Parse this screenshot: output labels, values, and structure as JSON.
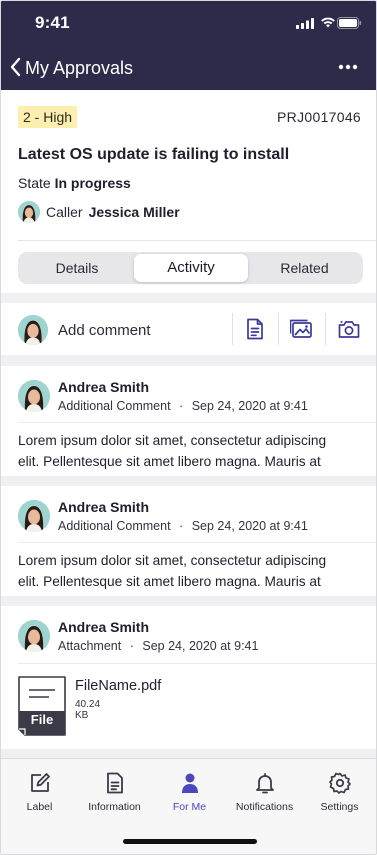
{
  "status_bar": {
    "time": "9:41"
  },
  "nav": {
    "back_label": "My Approvals",
    "more_icon": "ellipsis-icon"
  },
  "record": {
    "priority": "2 - High",
    "number": "PRJ0017046",
    "title": "Latest OS update is failing to install",
    "state_label": "State",
    "state_value": "In progress",
    "caller_label": "Caller",
    "caller_name": "Jessica Miller"
  },
  "tabs": [
    {
      "label": "Details",
      "active": false
    },
    {
      "label": "Activity",
      "active": true
    },
    {
      "label": "Related",
      "active": false
    }
  ],
  "composer": {
    "placeholder": "Add comment",
    "actions": [
      "document-icon",
      "image-icon",
      "camera-icon"
    ]
  },
  "feed": [
    {
      "author": "Andrea Smith",
      "type": "Additional Comment",
      "separator": "·",
      "date": "Sep 24, 2020 at 9:41",
      "body_line1": "Lorem ipsum dolor sit amet, consectetur adipiscing",
      "body_line2": "elit. Pellentesque sit amet libero magna. Mauris at"
    },
    {
      "author": "Andrea Smith",
      "type": "Additional Comment",
      "separator": "·",
      "date": "Sep 24, 2020 at 9:41",
      "body_line1": "Lorem ipsum dolor sit amet, consectetur adipiscing",
      "body_line2": "elit. Pellentesque sit amet libero magna. Mauris at"
    },
    {
      "author": "Andrea Smith",
      "type": "Attachment",
      "separator": "·",
      "date": "Sep 24, 2020 at 9:41",
      "file": {
        "badge": "File",
        "name": "FileName.pdf",
        "size": "40.24 KB"
      }
    }
  ],
  "tabbar": [
    {
      "label": "Label",
      "icon": "pencil-icon",
      "active": false
    },
    {
      "label": "Information",
      "icon": "document-icon",
      "active": false
    },
    {
      "label": "For Me",
      "icon": "person-icon",
      "active": true
    },
    {
      "label": "Notifications",
      "icon": "bell-icon",
      "active": false
    },
    {
      "label": "Settings",
      "icon": "gear-icon",
      "active": false
    }
  ],
  "colors": {
    "header_bg": "#2c2b4a",
    "accent": "#4b48b8",
    "priority_bg": "#fcefb0"
  }
}
